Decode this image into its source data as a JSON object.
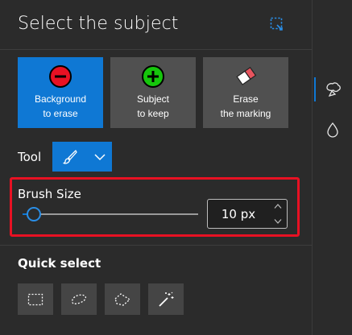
{
  "header": {
    "title": "Select the subject",
    "icon": "selection-dashed-icon"
  },
  "modes": [
    {
      "line1": "Background",
      "line2": "to erase",
      "icon": "minus-circle-red-icon",
      "selected": true
    },
    {
      "line1": "Subject",
      "line2": "to keep",
      "icon": "plus-circle-green-icon",
      "selected": false
    },
    {
      "line1": "Erase",
      "line2": "the marking",
      "icon": "eraser-icon",
      "selected": false
    }
  ],
  "tool": {
    "label": "Tool",
    "icon": "brush-icon",
    "dropdown_icon": "chevron-down-icon"
  },
  "brush": {
    "label": "Brush Size",
    "value_text": "10 px",
    "slider_fraction": 0.03
  },
  "quick_select": {
    "label": "Quick select",
    "tools": [
      "rectangle-select-icon",
      "lasso-select-icon",
      "polygon-select-icon",
      "magic-wand-icon"
    ]
  },
  "side_panel": {
    "items": [
      "subject-select-icon",
      "color-drop-icon"
    ]
  },
  "colors": {
    "accent": "#0f78d4",
    "highlight_border": "#e81123",
    "panel_bg": "#2b2b2b",
    "button_bg": "#505050"
  }
}
